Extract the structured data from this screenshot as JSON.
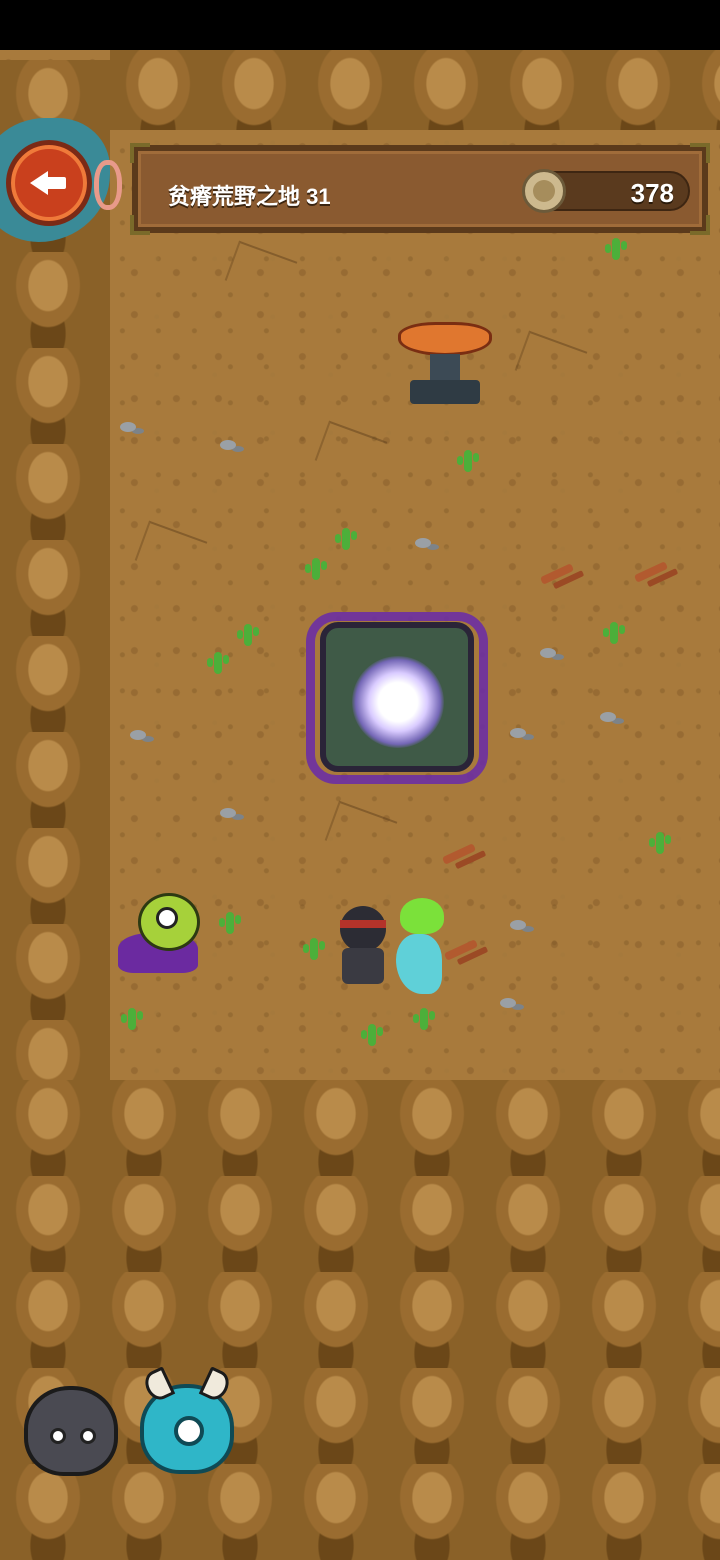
{
  "header": {
    "level_title": "贫瘠荒野之地 31",
    "coin_count": "378"
  },
  "colors": {
    "ground": "#a87a3c",
    "panel": "#8a5a30",
    "back_button": "#c9401d",
    "portal_glow": "#d9cbff"
  },
  "icons": {
    "back": "arrow-left-icon",
    "currency": "coin-icon",
    "portal": "portal-icon",
    "anvil": "anvil-icon"
  }
}
